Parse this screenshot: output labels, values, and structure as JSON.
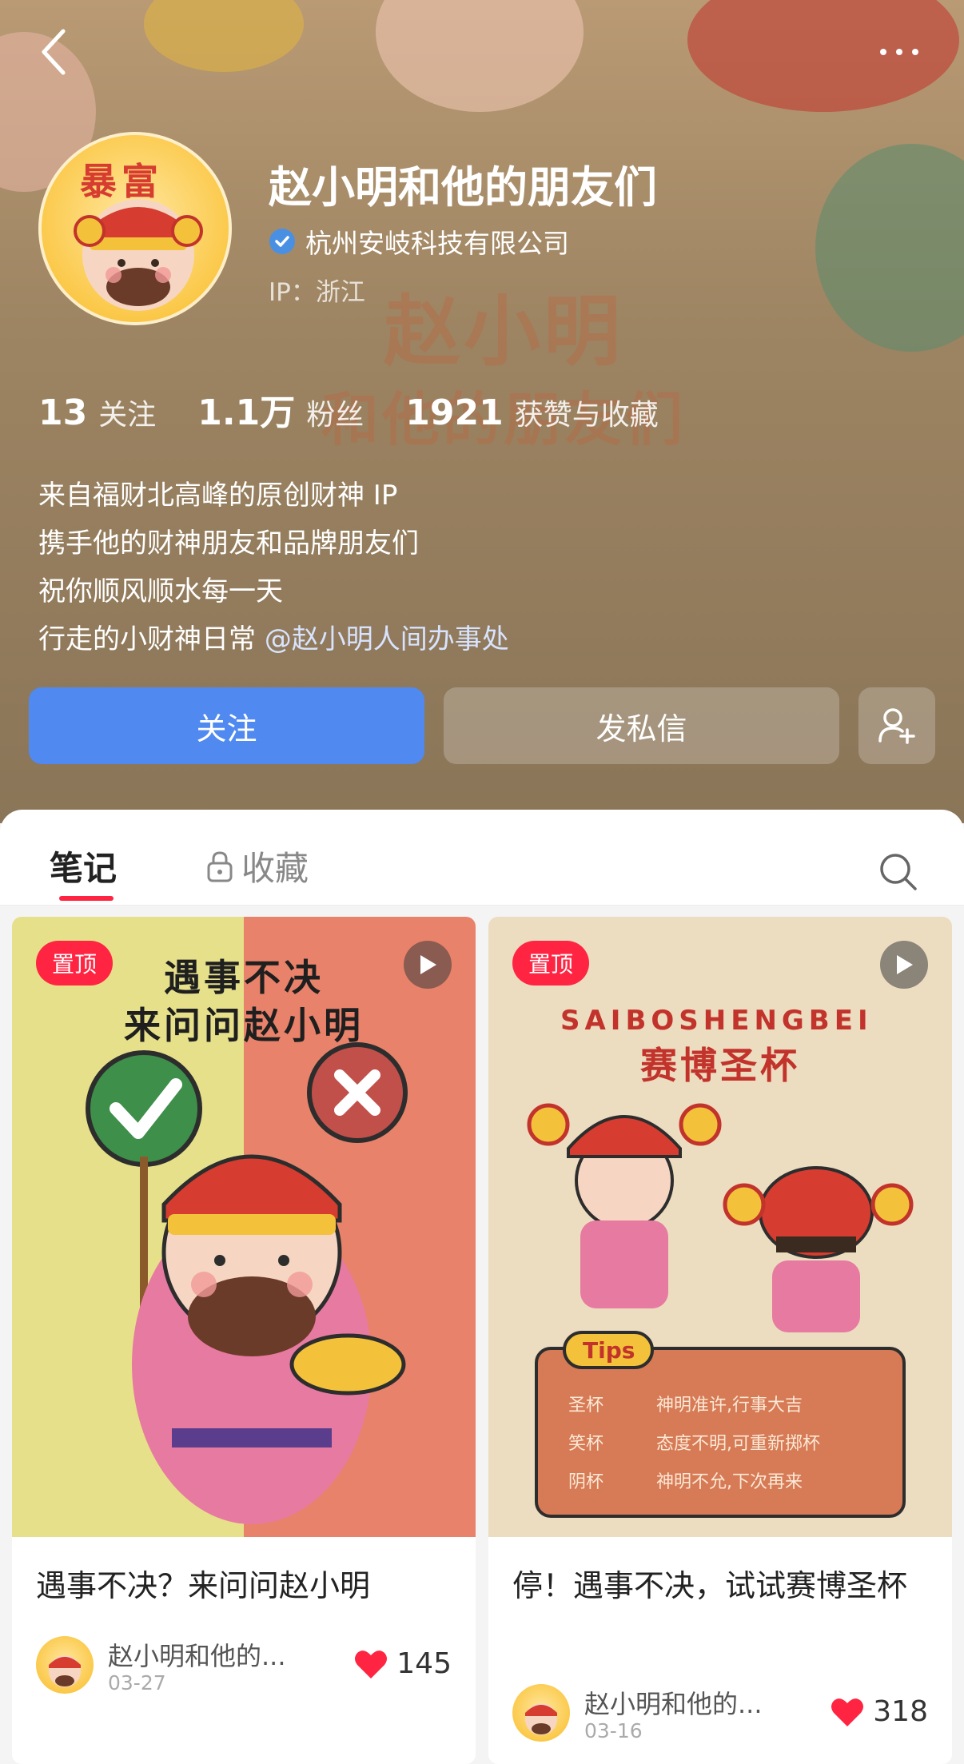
{
  "profile": {
    "name": "赵小明和他的朋友们",
    "verified_org": "杭州安岐科技有限公司",
    "ip": "IP：浙江",
    "bg_title_line1": "赵小明",
    "bg_title_line2": "和他的朋友们",
    "avatar_text": "暴富"
  },
  "stats": [
    {
      "value": "13",
      "label": "关注"
    },
    {
      "value": "1.1万",
      "label": "粉丝"
    },
    {
      "value": "1921",
      "label": "获赞与收藏"
    }
  ],
  "bio": {
    "line1": "来自福财北高峰的原创财神 IP",
    "line2": "携手他的财神朋友和品牌朋友们",
    "line3": "祝你顺风顺水每一天",
    "line4_prefix": "行走的小财神日常 ",
    "line4_mention": "@赵小明人间办事处"
  },
  "actions": {
    "follow": "关注",
    "message": "发私信"
  },
  "tabs": {
    "notes": "笔记",
    "collect": "收藏"
  },
  "cards": [
    {
      "pin": "置顶",
      "thumb_line1": "遇事不决",
      "thumb_line2": "来问问赵小明",
      "title": "遇事不决？来问问赵小明",
      "author": "赵小明和他的...",
      "date": "03-27",
      "likes": "145"
    },
    {
      "pin": "置顶",
      "thumb_arc": "SAIBOSHENGBEI",
      "thumb_line1": "赛博圣杯",
      "tips_label": "Tips",
      "tips": [
        {
          "name": "圣杯",
          "desc": "神明准许,行事大吉"
        },
        {
          "name": "笑杯",
          "desc": "态度不明,可重新掷杯"
        },
        {
          "name": "阴杯",
          "desc": "神明不允,下次再来"
        }
      ],
      "title": "停！遇事不决，试试赛博圣杯",
      "author": "赵小明和他的...",
      "date": "03-16",
      "likes": "318"
    }
  ],
  "colors": {
    "accent": "#ff2442",
    "follow_button": "#5089f0",
    "verified_badge": "#4a90e2"
  }
}
